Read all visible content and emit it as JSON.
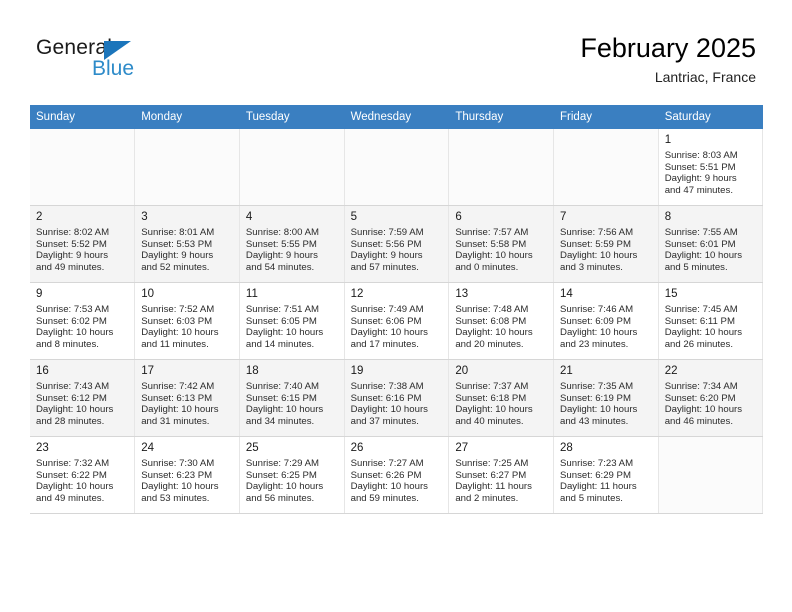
{
  "brand": {
    "name_part1": "General",
    "name_part2": "Blue",
    "triangle_icon": "triangle-icon",
    "color_dark": "#1a1a1a",
    "color_blue": "#2e8bc9",
    "color_triangle": "#1b75bb"
  },
  "header": {
    "title": "February 2025",
    "subtitle": "Lantriac, France"
  },
  "theme": {
    "header_row_bg": "#3a7fc1",
    "header_row_text": "#ffffff",
    "shaded_row_bg": "#f4f4f4",
    "cell_border": "#d6d6d6"
  },
  "weekdays": [
    "Sunday",
    "Monday",
    "Tuesday",
    "Wednesday",
    "Thursday",
    "Friday",
    "Saturday"
  ],
  "weeks": [
    {
      "shaded": false,
      "days": [
        {
          "empty": true
        },
        {
          "empty": true
        },
        {
          "empty": true
        },
        {
          "empty": true
        },
        {
          "empty": true
        },
        {
          "empty": true
        },
        {
          "empty": false,
          "date": "1",
          "sunrise": "Sunrise: 8:03 AM",
          "sunset": "Sunset: 5:51 PM",
          "daylight_line1": "Daylight: 9 hours",
          "daylight_line2": "and 47 minutes."
        }
      ]
    },
    {
      "shaded": true,
      "days": [
        {
          "empty": false,
          "date": "2",
          "sunrise": "Sunrise: 8:02 AM",
          "sunset": "Sunset: 5:52 PM",
          "daylight_line1": "Daylight: 9 hours",
          "daylight_line2": "and 49 minutes."
        },
        {
          "empty": false,
          "date": "3",
          "sunrise": "Sunrise: 8:01 AM",
          "sunset": "Sunset: 5:53 PM",
          "daylight_line1": "Daylight: 9 hours",
          "daylight_line2": "and 52 minutes."
        },
        {
          "empty": false,
          "date": "4",
          "sunrise": "Sunrise: 8:00 AM",
          "sunset": "Sunset: 5:55 PM",
          "daylight_line1": "Daylight: 9 hours",
          "daylight_line2": "and 54 minutes."
        },
        {
          "empty": false,
          "date": "5",
          "sunrise": "Sunrise: 7:59 AM",
          "sunset": "Sunset: 5:56 PM",
          "daylight_line1": "Daylight: 9 hours",
          "daylight_line2": "and 57 minutes."
        },
        {
          "empty": false,
          "date": "6",
          "sunrise": "Sunrise: 7:57 AM",
          "sunset": "Sunset: 5:58 PM",
          "daylight_line1": "Daylight: 10 hours",
          "daylight_line2": "and 0 minutes."
        },
        {
          "empty": false,
          "date": "7",
          "sunrise": "Sunrise: 7:56 AM",
          "sunset": "Sunset: 5:59 PM",
          "daylight_line1": "Daylight: 10 hours",
          "daylight_line2": "and 3 minutes."
        },
        {
          "empty": false,
          "date": "8",
          "sunrise": "Sunrise: 7:55 AM",
          "sunset": "Sunset: 6:01 PM",
          "daylight_line1": "Daylight: 10 hours",
          "daylight_line2": "and 5 minutes."
        }
      ]
    },
    {
      "shaded": false,
      "days": [
        {
          "empty": false,
          "date": "9",
          "sunrise": "Sunrise: 7:53 AM",
          "sunset": "Sunset: 6:02 PM",
          "daylight_line1": "Daylight: 10 hours",
          "daylight_line2": "and 8 minutes."
        },
        {
          "empty": false,
          "date": "10",
          "sunrise": "Sunrise: 7:52 AM",
          "sunset": "Sunset: 6:03 PM",
          "daylight_line1": "Daylight: 10 hours",
          "daylight_line2": "and 11 minutes."
        },
        {
          "empty": false,
          "date": "11",
          "sunrise": "Sunrise: 7:51 AM",
          "sunset": "Sunset: 6:05 PM",
          "daylight_line1": "Daylight: 10 hours",
          "daylight_line2": "and 14 minutes."
        },
        {
          "empty": false,
          "date": "12",
          "sunrise": "Sunrise: 7:49 AM",
          "sunset": "Sunset: 6:06 PM",
          "daylight_line1": "Daylight: 10 hours",
          "daylight_line2": "and 17 minutes."
        },
        {
          "empty": false,
          "date": "13",
          "sunrise": "Sunrise: 7:48 AM",
          "sunset": "Sunset: 6:08 PM",
          "daylight_line1": "Daylight: 10 hours",
          "daylight_line2": "and 20 minutes."
        },
        {
          "empty": false,
          "date": "14",
          "sunrise": "Sunrise: 7:46 AM",
          "sunset": "Sunset: 6:09 PM",
          "daylight_line1": "Daylight: 10 hours",
          "daylight_line2": "and 23 minutes."
        },
        {
          "empty": false,
          "date": "15",
          "sunrise": "Sunrise: 7:45 AM",
          "sunset": "Sunset: 6:11 PM",
          "daylight_line1": "Daylight: 10 hours",
          "daylight_line2": "and 26 minutes."
        }
      ]
    },
    {
      "shaded": true,
      "days": [
        {
          "empty": false,
          "date": "16",
          "sunrise": "Sunrise: 7:43 AM",
          "sunset": "Sunset: 6:12 PM",
          "daylight_line1": "Daylight: 10 hours",
          "daylight_line2": "and 28 minutes."
        },
        {
          "empty": false,
          "date": "17",
          "sunrise": "Sunrise: 7:42 AM",
          "sunset": "Sunset: 6:13 PM",
          "daylight_line1": "Daylight: 10 hours",
          "daylight_line2": "and 31 minutes."
        },
        {
          "empty": false,
          "date": "18",
          "sunrise": "Sunrise: 7:40 AM",
          "sunset": "Sunset: 6:15 PM",
          "daylight_line1": "Daylight: 10 hours",
          "daylight_line2": "and 34 minutes."
        },
        {
          "empty": false,
          "date": "19",
          "sunrise": "Sunrise: 7:38 AM",
          "sunset": "Sunset: 6:16 PM",
          "daylight_line1": "Daylight: 10 hours",
          "daylight_line2": "and 37 minutes."
        },
        {
          "empty": false,
          "date": "20",
          "sunrise": "Sunrise: 7:37 AM",
          "sunset": "Sunset: 6:18 PM",
          "daylight_line1": "Daylight: 10 hours",
          "daylight_line2": "and 40 minutes."
        },
        {
          "empty": false,
          "date": "21",
          "sunrise": "Sunrise: 7:35 AM",
          "sunset": "Sunset: 6:19 PM",
          "daylight_line1": "Daylight: 10 hours",
          "daylight_line2": "and 43 minutes."
        },
        {
          "empty": false,
          "date": "22",
          "sunrise": "Sunrise: 7:34 AM",
          "sunset": "Sunset: 6:20 PM",
          "daylight_line1": "Daylight: 10 hours",
          "daylight_line2": "and 46 minutes."
        }
      ]
    },
    {
      "shaded": false,
      "days": [
        {
          "empty": false,
          "date": "23",
          "sunrise": "Sunrise: 7:32 AM",
          "sunset": "Sunset: 6:22 PM",
          "daylight_line1": "Daylight: 10 hours",
          "daylight_line2": "and 49 minutes."
        },
        {
          "empty": false,
          "date": "24",
          "sunrise": "Sunrise: 7:30 AM",
          "sunset": "Sunset: 6:23 PM",
          "daylight_line1": "Daylight: 10 hours",
          "daylight_line2": "and 53 minutes."
        },
        {
          "empty": false,
          "date": "25",
          "sunrise": "Sunrise: 7:29 AM",
          "sunset": "Sunset: 6:25 PM",
          "daylight_line1": "Daylight: 10 hours",
          "daylight_line2": "and 56 minutes."
        },
        {
          "empty": false,
          "date": "26",
          "sunrise": "Sunrise: 7:27 AM",
          "sunset": "Sunset: 6:26 PM",
          "daylight_line1": "Daylight: 10 hours",
          "daylight_line2": "and 59 minutes."
        },
        {
          "empty": false,
          "date": "27",
          "sunrise": "Sunrise: 7:25 AM",
          "sunset": "Sunset: 6:27 PM",
          "daylight_line1": "Daylight: 11 hours",
          "daylight_line2": "and 2 minutes."
        },
        {
          "empty": false,
          "date": "28",
          "sunrise": "Sunrise: 7:23 AM",
          "sunset": "Sunset: 6:29 PM",
          "daylight_line1": "Daylight: 11 hours",
          "daylight_line2": "and 5 minutes."
        },
        {
          "empty": true
        }
      ]
    }
  ]
}
